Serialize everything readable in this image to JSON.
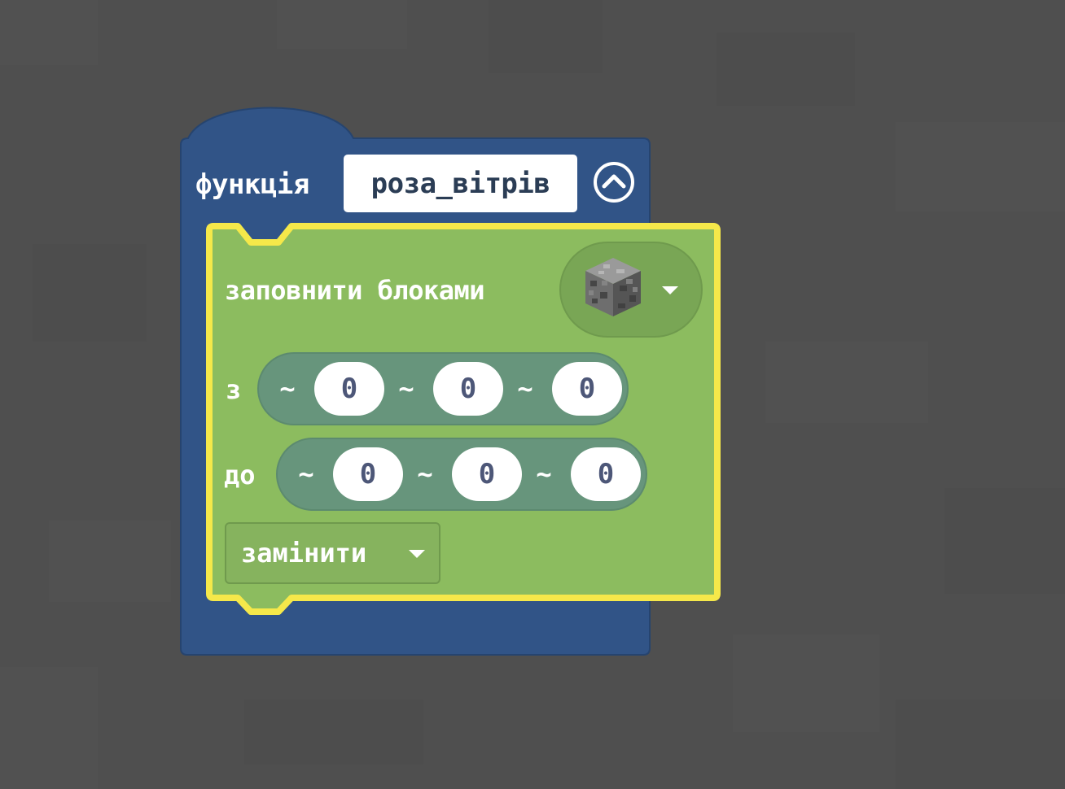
{
  "colors": {
    "workspace_bg": "#4f4f4f",
    "function_block": "#315487",
    "fill_block": "#8cbc5f",
    "selection_outline": "#f5e84a",
    "coordinate_pill": "#67957c"
  },
  "function_block": {
    "keyword": "функція",
    "name": "роза_вітрів",
    "collapse_icon": "chevron-up-circle-icon"
  },
  "fill_block": {
    "label": "заповнити блоками",
    "block_icon": "cobblestone-block-icon",
    "from_label": "з",
    "from": {
      "t1": "~",
      "x": "0",
      "t2": "~",
      "y": "0",
      "t3": "~",
      "z": "0"
    },
    "to_label": "до",
    "to": {
      "t1": "~",
      "x": "0",
      "t2": "~",
      "y": "0",
      "t3": "~",
      "z": "0"
    },
    "mode": "замінити"
  }
}
